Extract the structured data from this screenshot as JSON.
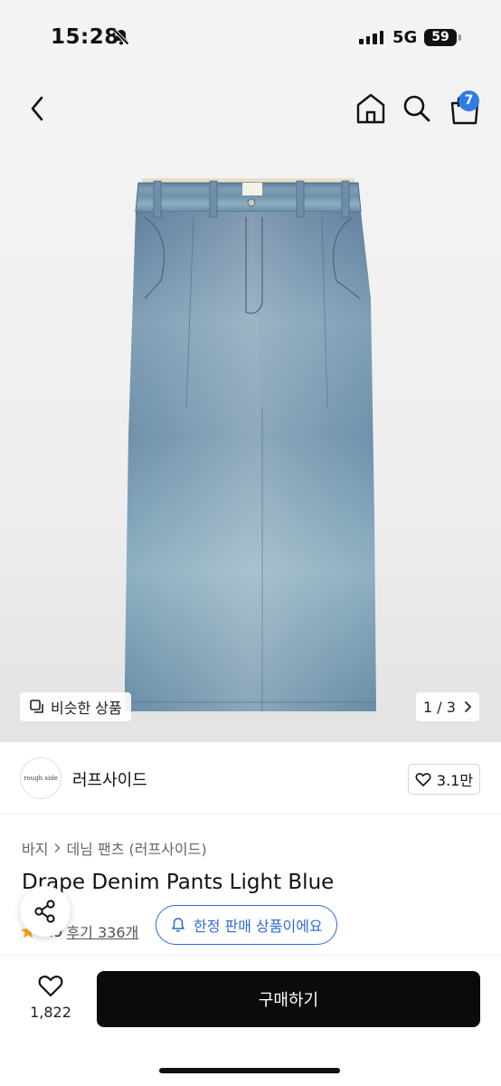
{
  "status_bar": {
    "time": "15:28",
    "network": "5G",
    "battery": "59"
  },
  "nav": {
    "cart_badge": "7",
    "icons": [
      "chevron-left-icon",
      "home-icon",
      "search-icon",
      "shopping-bag-icon"
    ]
  },
  "gallery": {
    "similar_label": "비슷한 상품",
    "pager": "1 / 3"
  },
  "brand": {
    "logo_text": "rough side",
    "name": "러프사이드",
    "likes": "3.1만"
  },
  "product": {
    "breadcrumb": [
      "바지",
      "데님 팬츠 (러프사이드)"
    ],
    "title": "Drape Denim Pants Light Blue",
    "rating": "4.9",
    "reviews": "후기 336개",
    "limited_label": "한정 판매 상품이에요"
  },
  "bottom": {
    "wish_count": "1,822",
    "buy_label": "구매하기"
  },
  "colors": {
    "accent_blue": "#2f6ad8",
    "badge_blue": "#2f7ce6",
    "buy_button": "#0b0b0b",
    "star": "#f5a623"
  }
}
